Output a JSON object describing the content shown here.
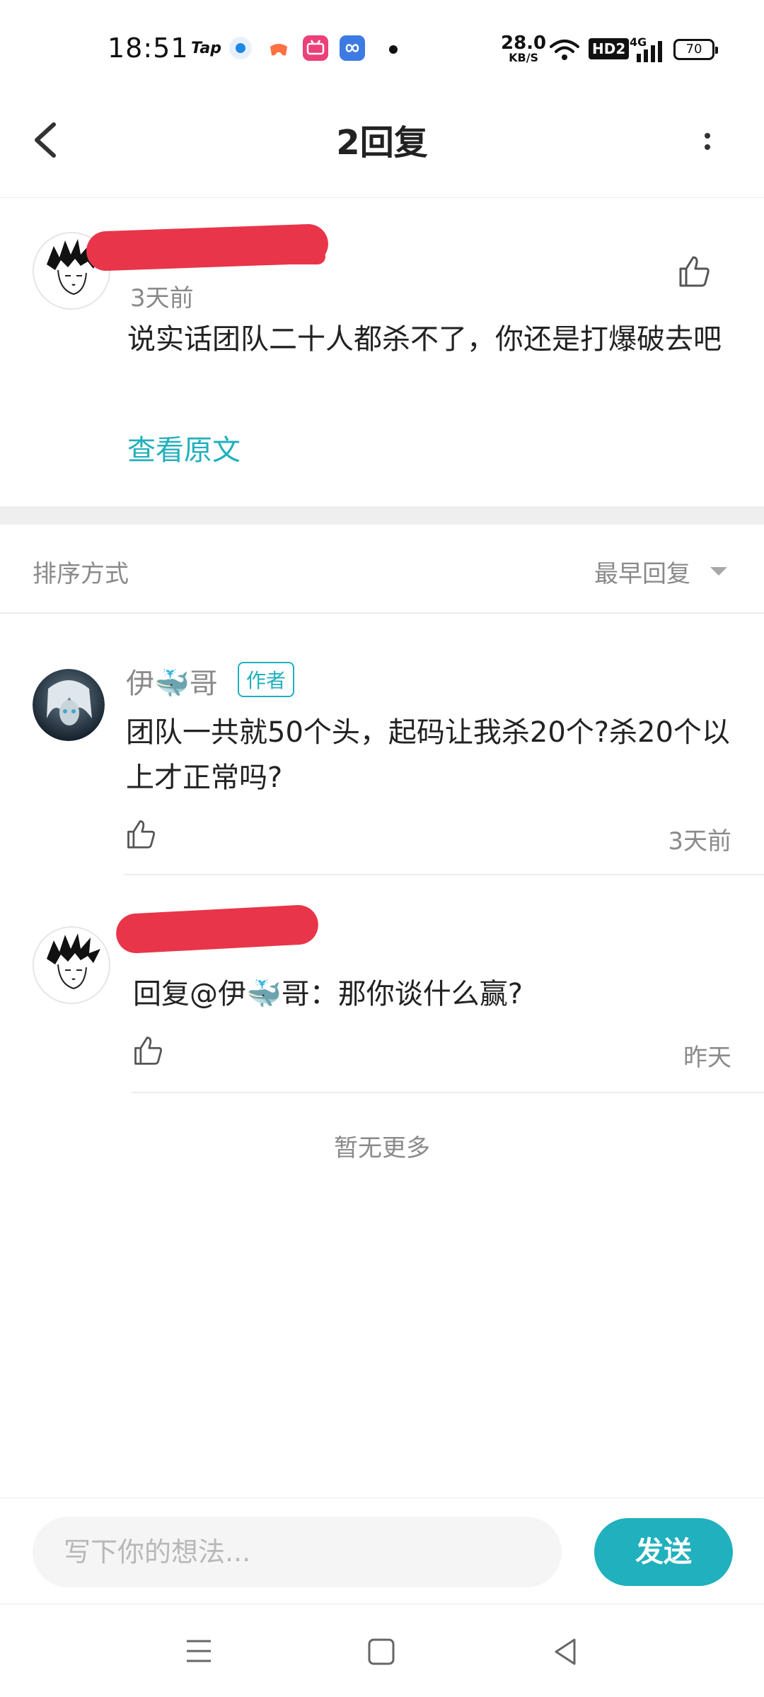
{
  "status_bar": {
    "time": "18:51",
    "tap_label": "Tap",
    "net_speed_value": "28.0",
    "net_speed_unit": "KB/S",
    "hd_label": "HD2",
    "network_type": "4G",
    "battery": "70",
    "app_icon_colors": [
      "#1e88e5",
      "#ff7043",
      "#ec407a",
      "#3d7be3"
    ]
  },
  "header": {
    "title": "2回复",
    "back_icon": "chevron-left-icon",
    "more_icon": "more-vertical-icon"
  },
  "main_post": {
    "time": "3天前",
    "content": "说实话团队二十人都杀不了，你还是打爆破去吧",
    "view_original": "查看原文"
  },
  "sort": {
    "label": "排序方式",
    "value": "最早回复"
  },
  "replies": [
    {
      "author": "伊🐳哥",
      "badge": "作者",
      "content": "团队一共就50个头，起码让我杀20个?杀20个以上才正常吗?",
      "time": "3天前"
    },
    {
      "content": "回复@伊🐳哥：那你谈什么赢?",
      "time": "昨天"
    }
  ],
  "no_more": "暂无更多",
  "composer": {
    "placeholder": "写下你的想法...",
    "send_label": "发送"
  },
  "colors": {
    "accent": "#21b0bd",
    "redaction": "#e8354a"
  }
}
